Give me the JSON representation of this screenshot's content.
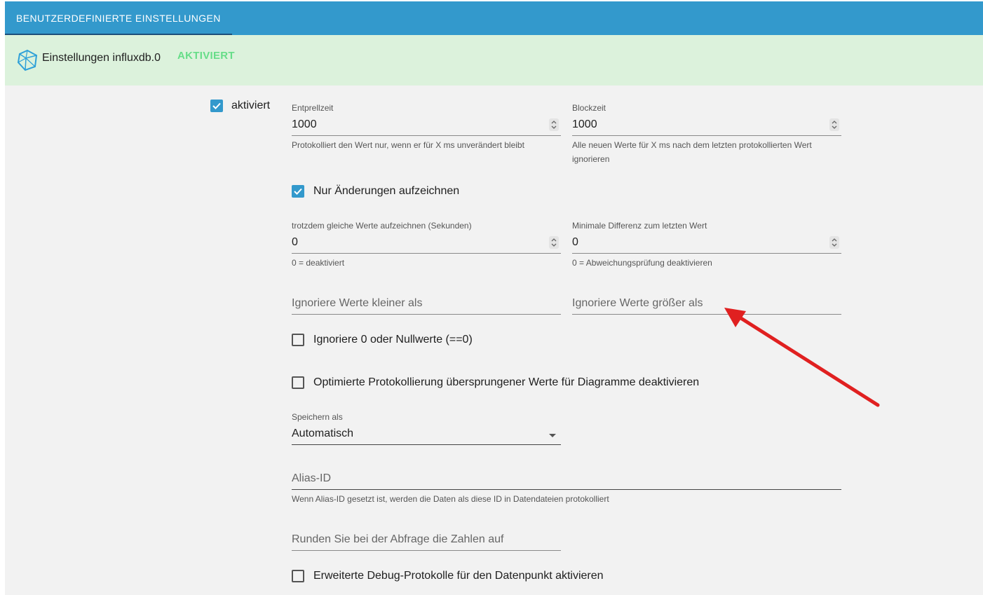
{
  "header": {
    "tab_label": "BENUTZERDEFINIERTE EINSTELLUNGEN"
  },
  "instance": {
    "name": "Einstellungen influxdb.0",
    "status": "AKTIVIERT",
    "icon": "influxdb-icon"
  },
  "enabled": {
    "label": "aktiviert",
    "checked": true
  },
  "debounce": {
    "label": "Entprellzeit",
    "value": "1000",
    "help": "Protokolliert den Wert nur, wenn er für X ms unverändert bleibt"
  },
  "blocktime": {
    "label": "Blockzeit",
    "value": "1000",
    "help": "Alle neuen Werte für X ms nach dem letzten protokollierten Wert ignorieren"
  },
  "changes_only": {
    "label": "Nur Änderungen aufzeichnen",
    "checked": true
  },
  "still_record": {
    "label": "trotzdem gleiche Werte aufzeichnen (Sekunden)",
    "value": "0",
    "help": "0 = deaktiviert"
  },
  "min_diff": {
    "label": "Minimale Differenz zum letzten Wert",
    "value": "0",
    "help": "0 = Abweichungsprüfung deaktivieren"
  },
  "ignore_below": {
    "placeholder": "Ignoriere Werte kleiner als"
  },
  "ignore_above": {
    "placeholder": "Ignoriere Werte größer als"
  },
  "ignore_zero": {
    "label": "Ignoriere 0 oder Nullwerte (==0)",
    "checked": false
  },
  "disable_skipped": {
    "label": "Optimierte Protokollierung übersprungener Werte für Diagramme deaktivieren",
    "checked": false
  },
  "store_as": {
    "label": "Speichern als",
    "value": "Automatisch"
  },
  "alias": {
    "placeholder": "Alias-ID",
    "help": "Wenn Alias-ID gesetzt ist, werden die Daten als diese ID in Datendateien protokolliert"
  },
  "round": {
    "placeholder": "Runden Sie bei der Abfrage die Zahlen auf"
  },
  "debug": {
    "label": "Erweiterte Debug-Protokolle für den Datenpunkt aktivieren",
    "checked": false
  },
  "colors": {
    "accent": "#3399cc",
    "instance_bg": "#dcf2dc",
    "status": "#66dd88",
    "annotation_arrow": "#e02020"
  }
}
